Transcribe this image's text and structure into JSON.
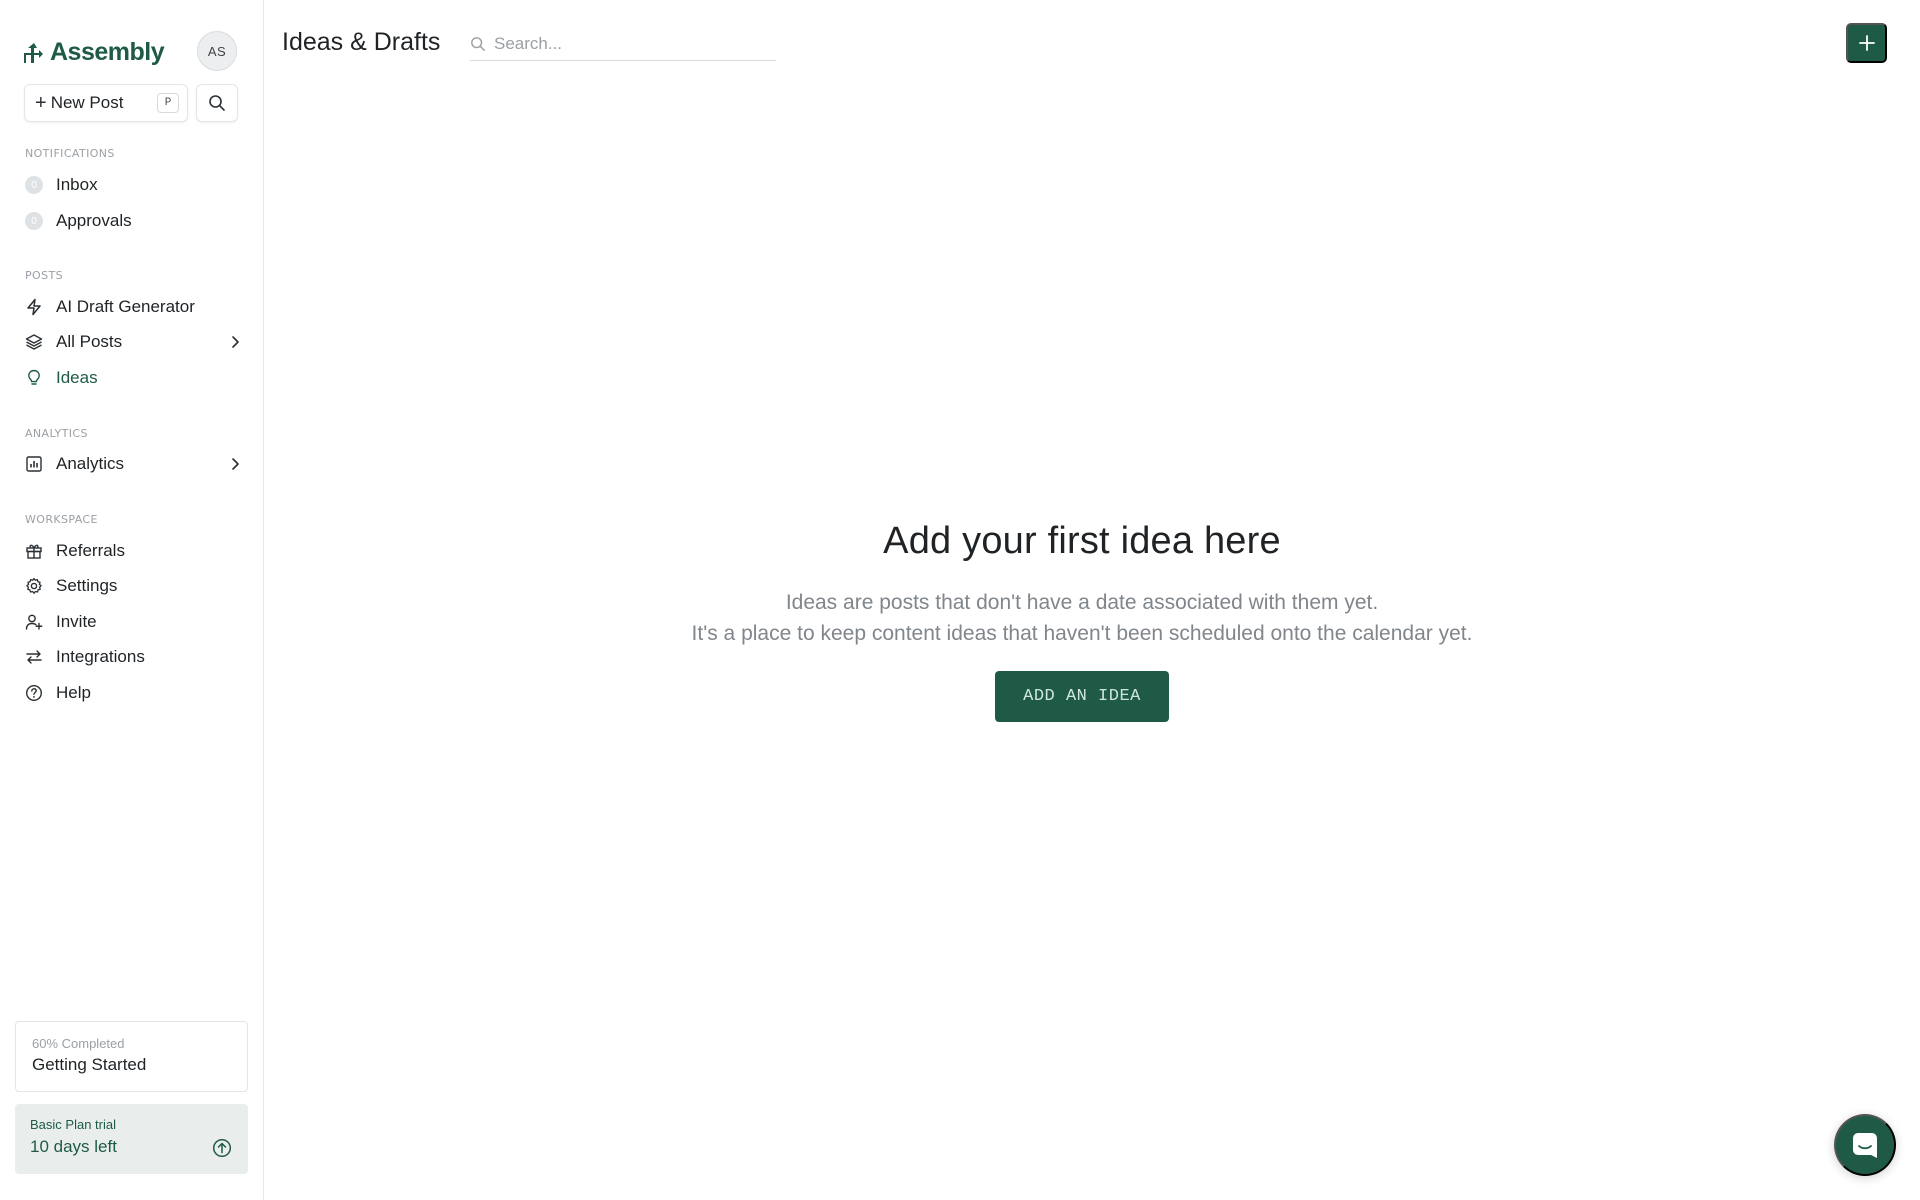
{
  "sidebar": {
    "logo_text": "Assembly",
    "avatar_initials": "AS",
    "new_post_label": "New Post",
    "new_post_shortcut": "P",
    "sections": {
      "notifications": "NOTIFICATIONS",
      "posts": "POSTS",
      "analytics": "ANALYTICS",
      "workspace": "WORKSPACE"
    },
    "items": {
      "inbox": {
        "label": "Inbox",
        "count": "0"
      },
      "approvals": {
        "label": "Approvals",
        "count": "0"
      },
      "ai_draft": {
        "label": "AI Draft Generator"
      },
      "all_posts": {
        "label": "All Posts"
      },
      "ideas": {
        "label": "Ideas"
      },
      "analytics": {
        "label": "Analytics"
      },
      "referrals": {
        "label": "Referrals"
      },
      "settings": {
        "label": "Settings"
      },
      "invite": {
        "label": "Invite"
      },
      "integrations": {
        "label": "Integrations"
      },
      "help": {
        "label": "Help"
      }
    },
    "progress": {
      "status": "60% Completed",
      "label": "Getting Started",
      "percent": 60
    },
    "trial": {
      "plan": "Basic Plan trial",
      "remaining": "10 days left"
    }
  },
  "header": {
    "title": "Ideas & Drafts",
    "search_placeholder": "Search..."
  },
  "empty_state": {
    "heading": "Add your first idea here",
    "line1": "Ideas are posts that don't have a date associated with them yet.",
    "line2": "It's a place to keep content ideas that haven't been scheduled onto the calendar yet.",
    "cta_label": "ADD AN IDEA"
  },
  "colors": {
    "brand": "#1f5a47",
    "trial_bg": "#e9eeec",
    "muted_text": "#80868b"
  }
}
